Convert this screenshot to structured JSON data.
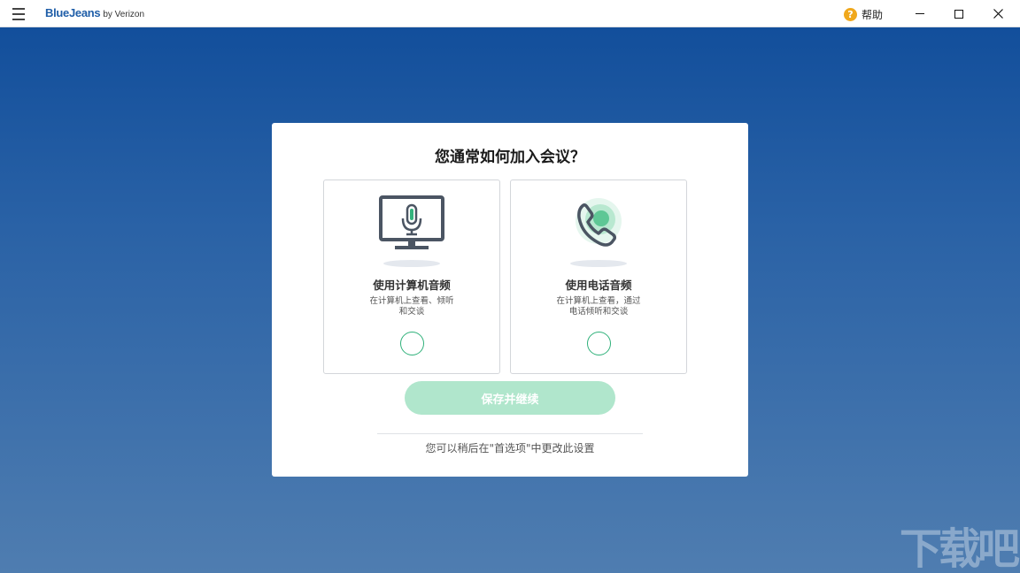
{
  "titlebar": {
    "brand": "BlueJeans",
    "brand_suffix": "by Verizon",
    "help_label": "帮助",
    "icons": {
      "menu": "hamburger-menu-icon",
      "help": "help-question-icon",
      "minimize": "minimize-icon",
      "maximize": "maximize-icon",
      "close": "close-icon"
    }
  },
  "dialog": {
    "title": "您通常如何加入会议？",
    "options": [
      {
        "title": "使用计算机音频",
        "desc_line1": "在计算机上查看、倾听",
        "desc_line2": "和交谈",
        "icon": "computer-microphone-icon"
      },
      {
        "title": "使用电话音频",
        "desc_line1": "在计算机上查看，通过",
        "desc_line2": "电话倾听和交谈",
        "icon": "phone-icon"
      }
    ],
    "save_button": "保存并继续",
    "footnote": "您可以稍后在\"首选项\"中更改此设置"
  },
  "watermark": "下载吧",
  "colors": {
    "accent_green": "#2fb17a",
    "button_disabled": "#b0e6cc",
    "brand_blue": "#1f5ea8",
    "background_top": "#0f4c9a",
    "background_bottom": "#4f7db0"
  }
}
